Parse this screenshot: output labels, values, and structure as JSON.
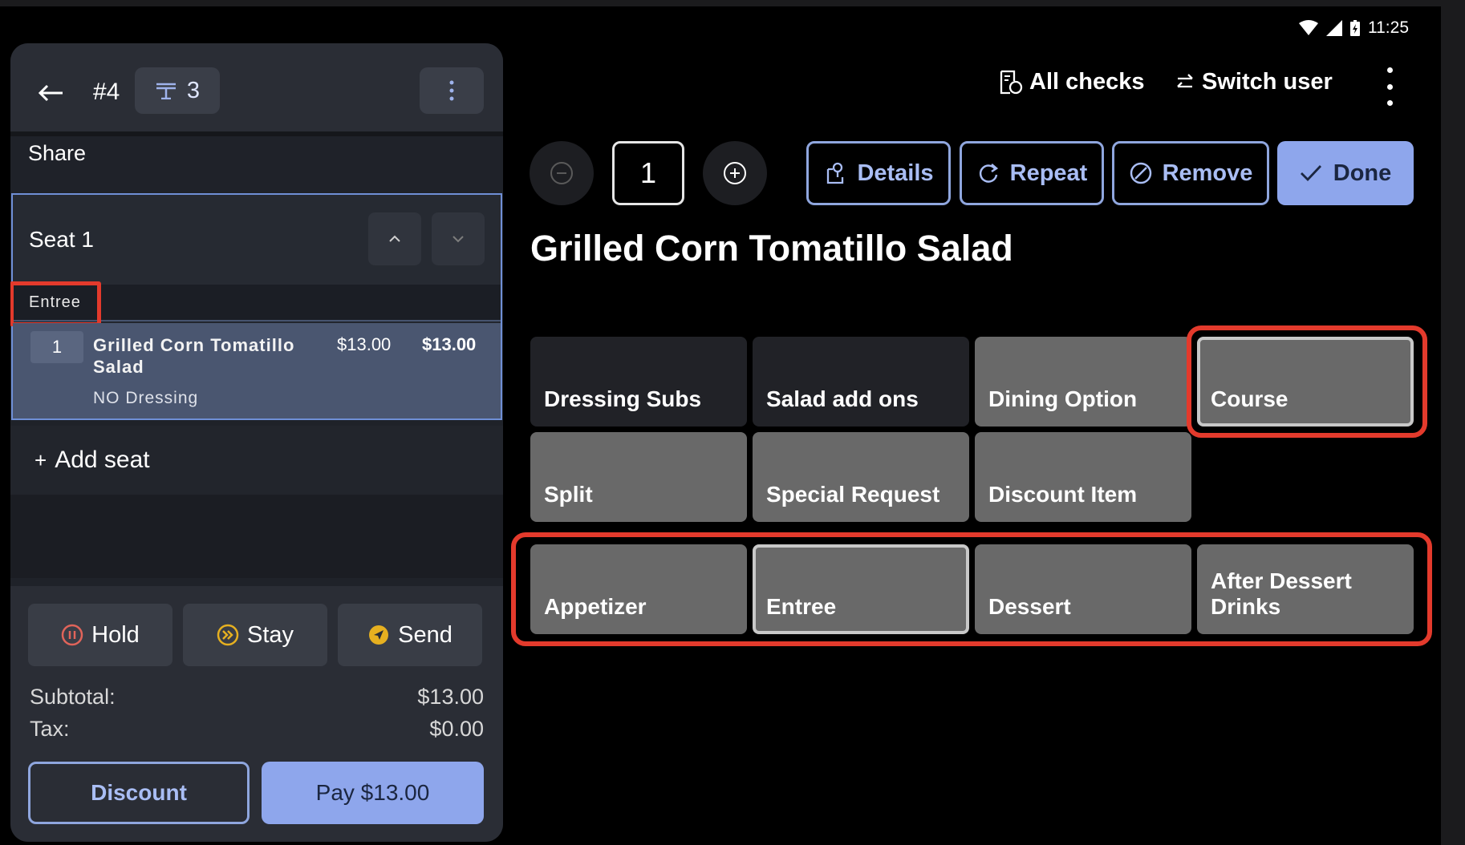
{
  "status": {
    "time": "11:25"
  },
  "check": {
    "number": "#4",
    "table": "3",
    "share_label": "Share"
  },
  "seat": {
    "label": "Seat 1",
    "course": "Entree",
    "item": {
      "qty": "1",
      "name": "Grilled Corn Tomatillo Salad",
      "price": "$13.00",
      "total": "$13.00",
      "modifier": "NO Dressing"
    }
  },
  "add_seat": {
    "plus": "+",
    "label": "Add seat"
  },
  "actions": {
    "hold": "Hold",
    "stay": "Stay",
    "send": "Send"
  },
  "totals": {
    "subtotal_label": "Subtotal:",
    "subtotal": "$13.00",
    "tax_label": "Tax:",
    "tax": "$0.00"
  },
  "footer": {
    "discount": "Discount",
    "pay": "Pay $13.00"
  },
  "topbar": {
    "all_checks": "All checks",
    "switch_user": "Switch user"
  },
  "editor": {
    "qty": "1",
    "details": "Details",
    "repeat": "Repeat",
    "remove": "Remove",
    "done": "Done",
    "title": "Grilled Corn Tomatillo Salad"
  },
  "modifier_groups": {
    "dressing_subs": "Dressing Subs",
    "salad_add_ons": "Salad add ons",
    "dining_option": "Dining Option",
    "course": "Course",
    "split": "Split",
    "special_request": "Special Request",
    "discount_item": "Discount Item"
  },
  "courses": {
    "appetizer": "Appetizer",
    "entree": "Entree",
    "dessert": "Dessert",
    "after_dessert_drinks": "After Dessert Drinks",
    "selected": "Entree"
  },
  "colors": {
    "accent": "#8ea6ec",
    "highlight": "#e33a2c",
    "selected_item": "#4a5670"
  }
}
